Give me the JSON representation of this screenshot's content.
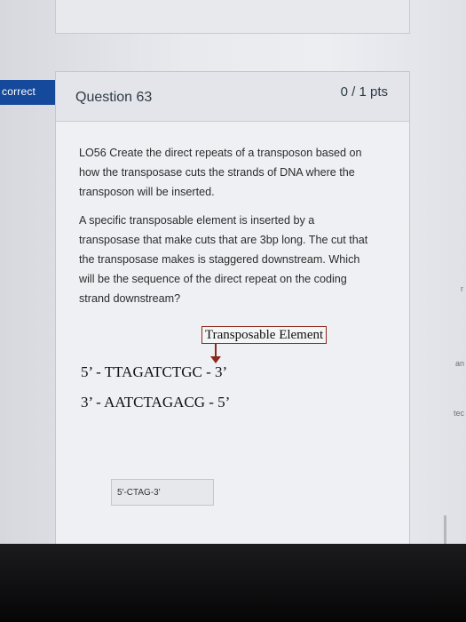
{
  "status_flag": "correct",
  "question": {
    "title": "Question 63",
    "points": "0 / 1 pts",
    "paragraph1": "LO56 Create the direct repeats of a transposon based on how the transposase cuts the strands of DNA where the transposon will be inserted.",
    "paragraph2": "A specific transposable element is inserted by a transposase that make cuts that are 3bp long. The cut that the transposase makes is staggered downstream. Which will be the sequence of the direct repeat on the coding strand downstream?"
  },
  "diagram": {
    "element_label": "Transposable Element",
    "top_strand": "5’ - TTAGATCTGC - 3’",
    "bottom_strand": "3’ - AATCTAGACG - 5’"
  },
  "answer": {
    "value": "5'-CTAG-3'"
  },
  "side_fragments": {
    "r": "r",
    "an": "an",
    "tec": "tec"
  },
  "colors": {
    "flag": "#15499b",
    "arrow": "#8b2a1c"
  }
}
